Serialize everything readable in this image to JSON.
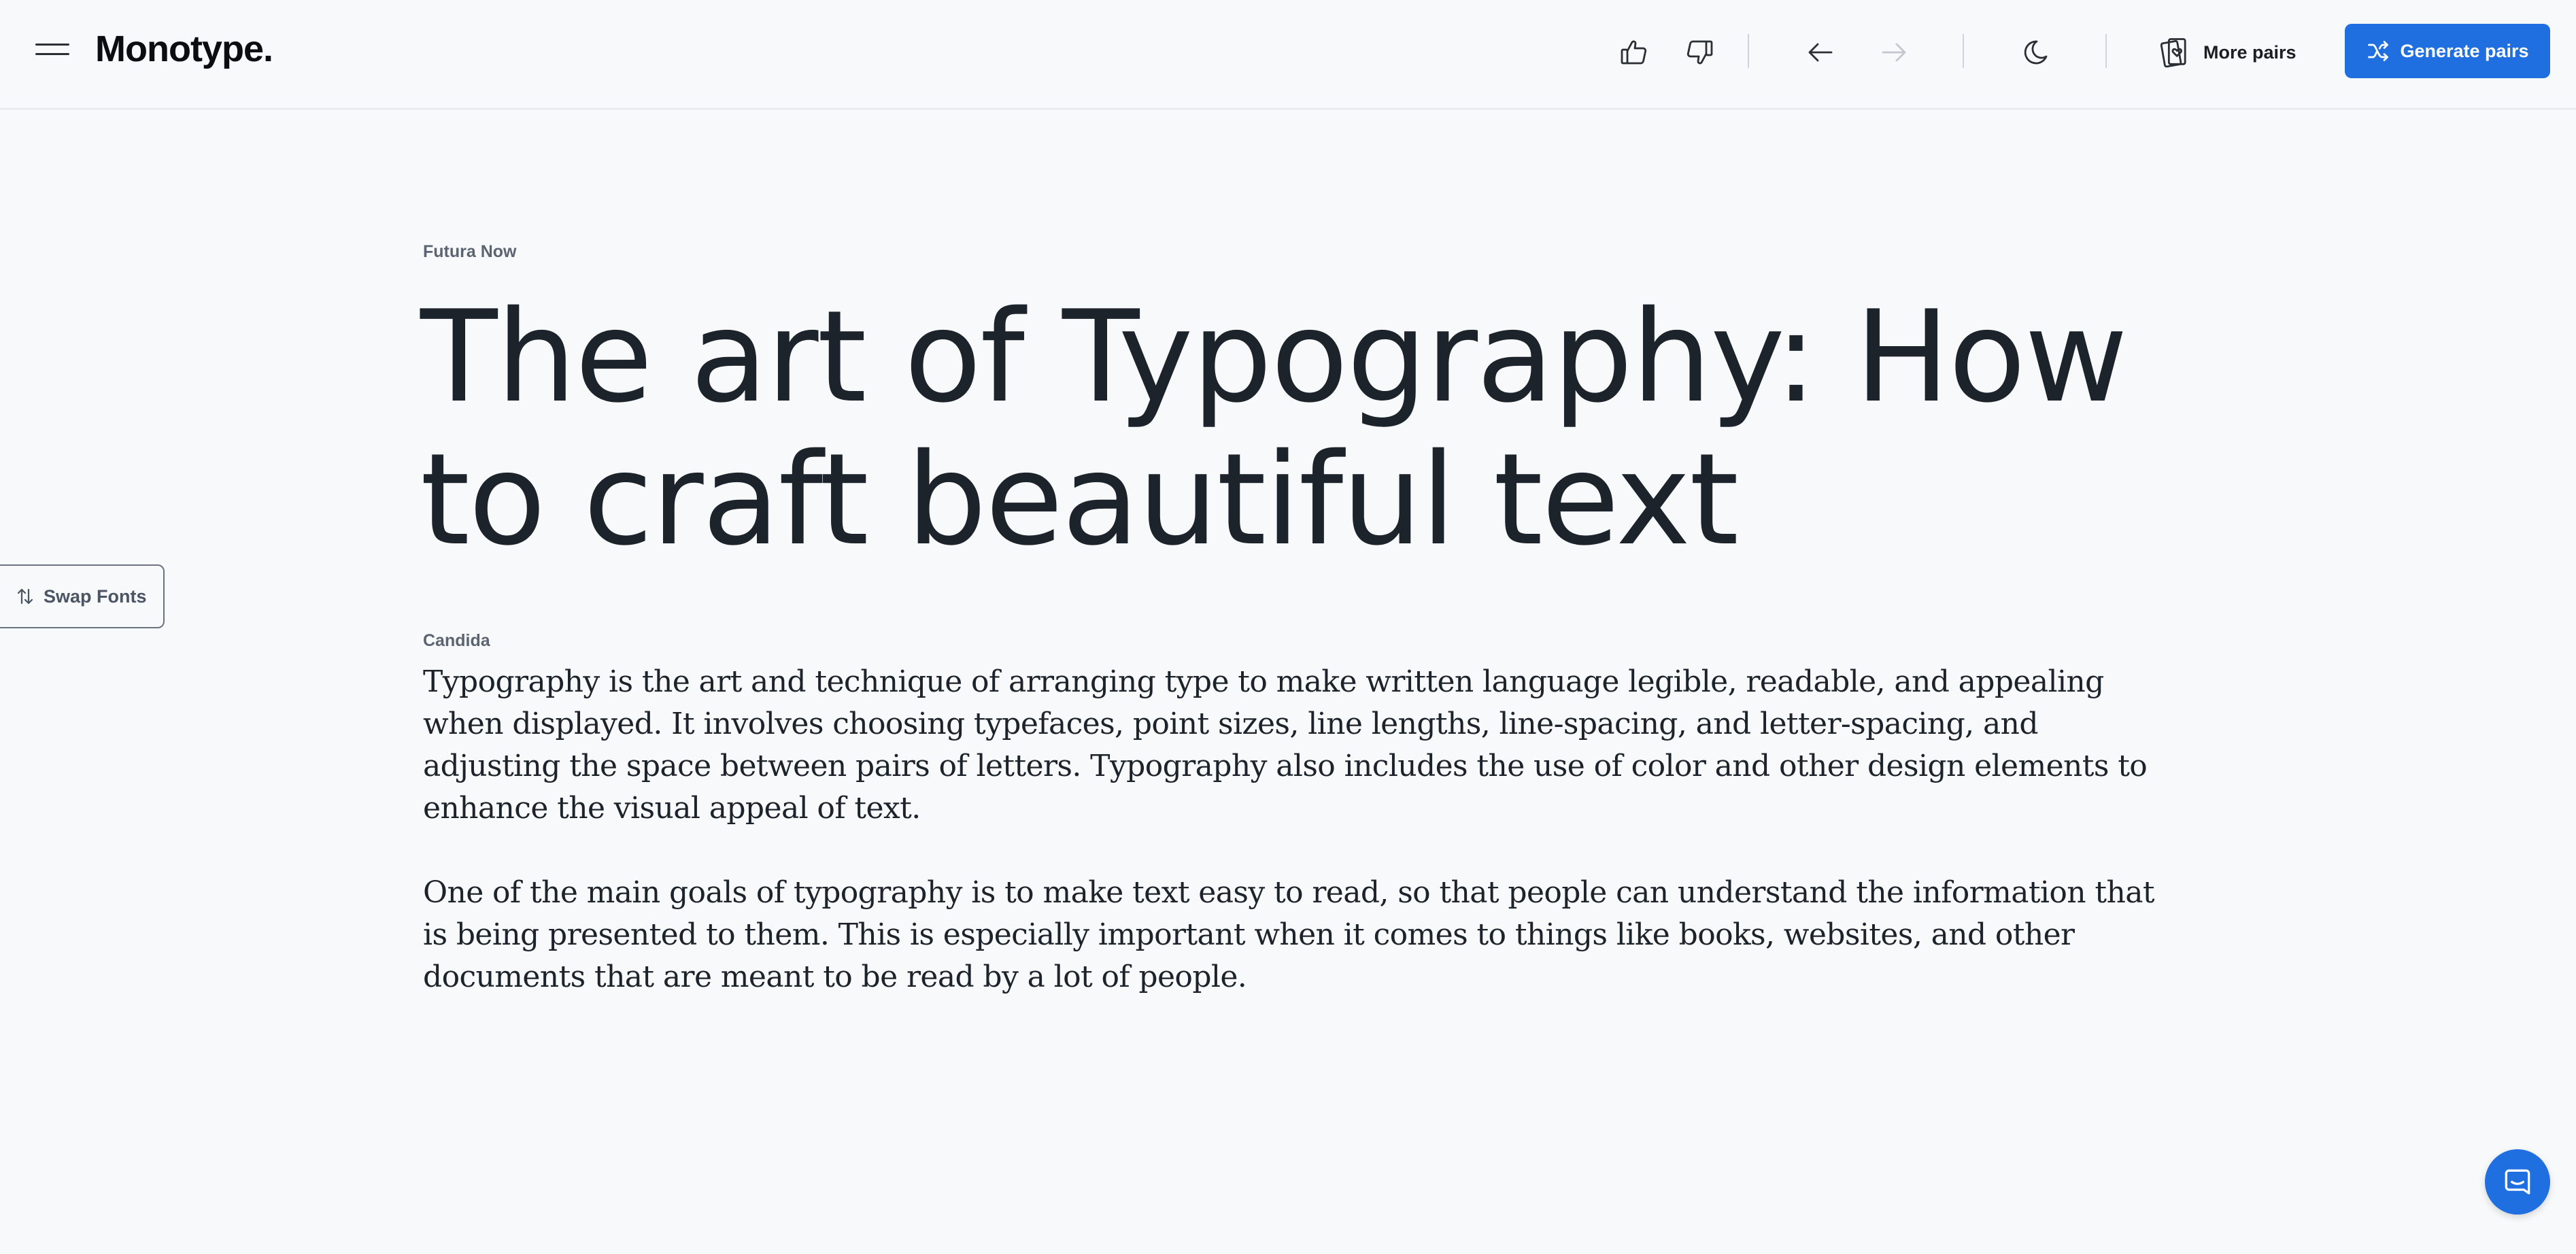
{
  "header": {
    "logo": "Monotype.",
    "more_pairs_label": "More pairs",
    "generate_label": "Generate pairs",
    "icons": {
      "menu": "hamburger-menu-icon",
      "like": "thumbs-up-icon",
      "dislike": "thumbs-down-icon",
      "back": "arrow-left-icon",
      "forward": "arrow-right-icon",
      "theme": "moon-icon",
      "more_pairs": "cards-heart-icon",
      "generate": "shuffle-icon"
    },
    "colors": {
      "accent": "#1f6fe0",
      "forward_disabled": "#c3c8cf"
    }
  },
  "content": {
    "heading_font": "Futura Now",
    "headline": "The art of Typography: How to craft beautiful text",
    "body_font": "Candida",
    "paragraphs": [
      "Typography is the art and technique of arranging type to make written language legible, readable, and appealing when displayed. It involves choosing typefaces, point sizes, line lengths, line-spacing, and letter-spacing, and adjusting the space between pairs of letters. Typography also includes the use of color and other design elements to enhance the visual appeal of text.",
      "One of the main goals of typography is to make text easy to read, so that people can understand the information that is being presented to them. This is especially important when it comes to things like books, websites, and other documents that are meant to be read by a lot of people."
    ]
  },
  "swap": {
    "label": "Swap Fonts",
    "icon": "swap-arrows-icon"
  },
  "chat": {
    "icon": "chat-icon"
  }
}
